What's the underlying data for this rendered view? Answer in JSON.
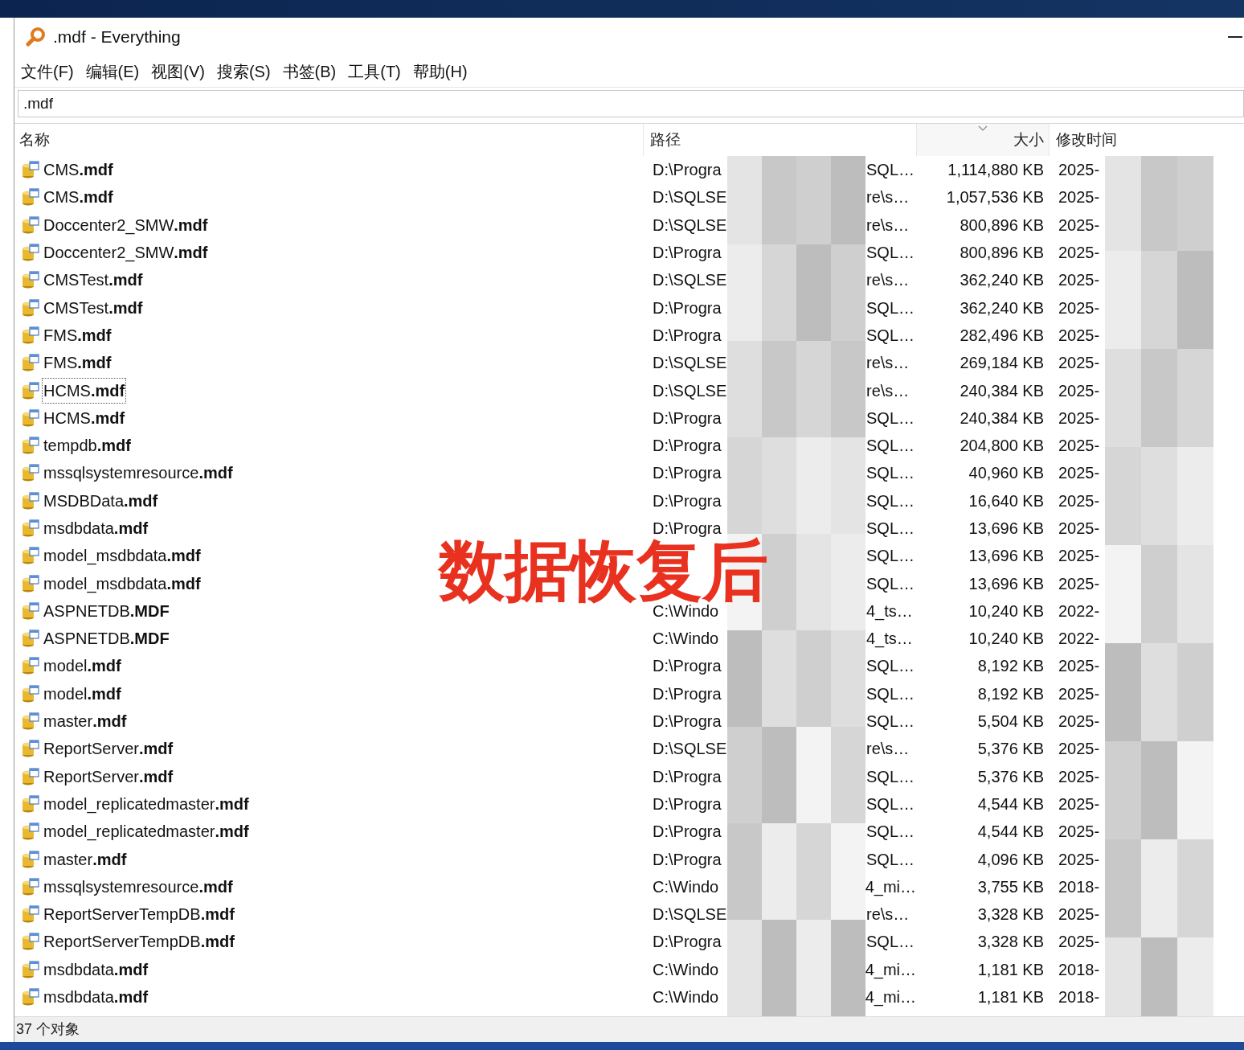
{
  "window": {
    "title": ".mdf - Everything"
  },
  "menu": [
    "文件(F)",
    "编辑(E)",
    "视图(V)",
    "搜索(S)",
    "书签(B)",
    "工具(T)",
    "帮助(H)"
  ],
  "search": {
    "value": ".mdf"
  },
  "columns": [
    {
      "label": "名称",
      "sorted": false
    },
    {
      "label": "路径",
      "sorted": false
    },
    {
      "label": "大小",
      "sorted": true
    },
    {
      "label": "修改时间",
      "sorted": false
    }
  ],
  "rows": [
    {
      "name": "CMS**.mdf**",
      "path_head": "D:\\Progra",
      "path_tail": "SQL…",
      "size": "1,114,880 KB",
      "modified": "2025-",
      "focused": false
    },
    {
      "name": "CMS**.mdf**",
      "path_head": "D:\\SQLSE",
      "path_tail": "re\\s…",
      "size": "1,057,536 KB",
      "modified": "2025-",
      "focused": false
    },
    {
      "name": "Doccenter2_SMW**.mdf**",
      "path_head": "D:\\SQLSE",
      "path_tail": "re\\s…",
      "size": "800,896 KB",
      "modified": "2025-",
      "focused": false
    },
    {
      "name": "Doccenter2_SMW**.mdf**",
      "path_head": "D:\\Progra",
      "path_tail": "SQL…",
      "size": "800,896 KB",
      "modified": "2025-",
      "focused": false
    },
    {
      "name": "CMSTest**.mdf**",
      "path_head": "D:\\SQLSE",
      "path_tail": "re\\s…",
      "size": "362,240 KB",
      "modified": "2025-",
      "focused": false
    },
    {
      "name": "CMSTest**.mdf**",
      "path_head": "D:\\Progra",
      "path_tail": "SQL…",
      "size": "362,240 KB",
      "modified": "2025-",
      "focused": false
    },
    {
      "name": "FMS**.mdf**",
      "path_head": "D:\\Progra",
      "path_tail": "SQL…",
      "size": "282,496 KB",
      "modified": "2025-",
      "focused": false
    },
    {
      "name": "FMS**.mdf**",
      "path_head": "D:\\SQLSE",
      "path_tail": "re\\s…",
      "size": "269,184 KB",
      "modified": "2025-",
      "focused": false
    },
    {
      "name": "HCMS**.mdf**",
      "path_head": "D:\\SQLSE",
      "path_tail": "re\\s…",
      "size": "240,384 KB",
      "modified": "2025-",
      "focused": true
    },
    {
      "name": "HCMS**.mdf**",
      "path_head": "D:\\Progra",
      "path_tail": "SQL…",
      "size": "240,384 KB",
      "modified": "2025-",
      "focused": false
    },
    {
      "name": "tempdb**.mdf**",
      "path_head": "D:\\Progra",
      "path_tail": "SQL…",
      "size": "204,800 KB",
      "modified": "2025-",
      "focused": false
    },
    {
      "name": "mssqlsystemresource**.mdf**",
      "path_head": "D:\\Progra",
      "path_tail": "SQL…",
      "size": "40,960 KB",
      "modified": "2025-",
      "focused": false
    },
    {
      "name": "MSDBData**.mdf**",
      "path_head": "D:\\Progra",
      "path_tail": "SQL…",
      "size": "16,640 KB",
      "modified": "2025-",
      "focused": false
    },
    {
      "name": "msdbdata**.mdf**",
      "path_head": "D:\\Progra",
      "path_tail": "SQL…",
      "size": "13,696 KB",
      "modified": "2025-",
      "focused": false
    },
    {
      "name": "model_msdbdata**.mdf**",
      "path_tail": "SQL…",
      "size": "13,696 KB",
      "modified": "2025-",
      "focused": false
    },
    {
      "name": "model_msdbdata**.mdf**",
      "path_tail": "SQL…",
      "size": "13,696 KB",
      "modified": "2025-",
      "focused": false
    },
    {
      "name": "ASPNETDB**.MDF**",
      "path_head": "C:\\Windo",
      "path_tail": "4_ts…",
      "size": "10,240 KB",
      "modified": "2022-",
      "focused": false
    },
    {
      "name": "ASPNETDB**.MDF**",
      "path_head": "C:\\Windo",
      "path_tail": "4_ts…",
      "size": "10,240 KB",
      "modified": "2022-",
      "focused": false
    },
    {
      "name": "model**.mdf**",
      "path_head": "D:\\Progra",
      "path_tail": "SQL…",
      "size": "8,192 KB",
      "modified": "2025-",
      "focused": false
    },
    {
      "name": "model**.mdf**",
      "path_head": "D:\\Progra",
      "path_tail": "SQL…",
      "size": "8,192 KB",
      "modified": "2025-",
      "focused": false
    },
    {
      "name": "master**.mdf**",
      "path_head": "D:\\Progra",
      "path_tail": "SQL…",
      "size": "5,504 KB",
      "modified": "2025-",
      "focused": false
    },
    {
      "name": "ReportServer**.mdf**",
      "path_head": "D:\\SQLSE",
      "path_tail": "re\\s…",
      "size": "5,376 KB",
      "modified": "2025-",
      "focused": false
    },
    {
      "name": "ReportServer**.mdf**",
      "path_head": "D:\\Progra",
      "path_tail": "SQL…",
      "size": "5,376 KB",
      "modified": "2025-",
      "focused": false
    },
    {
      "name": "model_replicatedmaster**.mdf**",
      "path_head": "D:\\Progra",
      "path_tail": "SQL…",
      "size": "4,544 KB",
      "modified": "2025-",
      "focused": false
    },
    {
      "name": "model_replicatedmaster**.mdf**",
      "path_head": "D:\\Progra",
      "path_tail": "SQL…",
      "size": "4,544 KB",
      "modified": "2025-",
      "focused": false
    },
    {
      "name": "master**.mdf**",
      "path_head": "D:\\Progra",
      "path_tail": "SQL…",
      "size": "4,096 KB",
      "modified": "2025-",
      "focused": false
    },
    {
      "name": "mssqlsystemresource**.mdf**",
      "path_head": "C:\\Windo",
      "path_tail": "4_mi…",
      "size": "3,755 KB",
      "modified": "2018-",
      "focused": false
    },
    {
      "name": "ReportServerTempDB**.mdf**",
      "path_head": "D:\\SQLSE",
      "path_tail": "re\\s…",
      "size": "3,328 KB",
      "modified": "2025-",
      "focused": false
    },
    {
      "name": "ReportServerTempDB**.mdf**",
      "path_head": "D:\\Progra",
      "path_tail": "SQL…",
      "size": "3,328 KB",
      "modified": "2025-",
      "focused": false
    },
    {
      "name": "msdbdata**.mdf**",
      "path_head": "C:\\Windo",
      "path_tail": "4_mi…",
      "size": "1,181 KB",
      "modified": "2018-",
      "focused": false
    },
    {
      "name": "msdbdata**.mdf**",
      "path_head": "C:\\Windo",
      "path_tail": "4_mi…",
      "size": "1,181 KB",
      "modified": "2018-",
      "focused": false
    }
  ],
  "status_bar": "37 个对象",
  "overlay_caption": "数据恢复后"
}
